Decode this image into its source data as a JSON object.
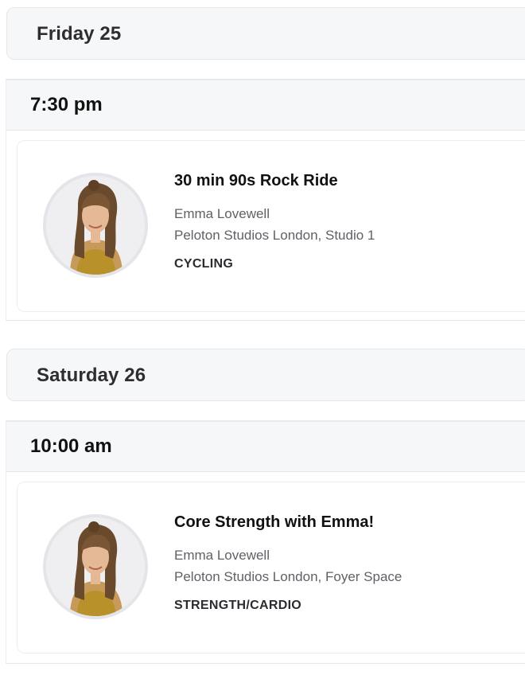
{
  "schedule": [
    {
      "day": "Friday 25",
      "time": "7:30 pm",
      "class": {
        "title": "30 min 90s Rock Ride",
        "instructor": "Emma Lovewell",
        "location": "Peloton Studios London, Studio 1",
        "category": "CYCLING",
        "avatar_icon": "instructor-photo"
      }
    },
    {
      "day": "Saturday 26",
      "time": "10:00 am",
      "class": {
        "title": "Core Strength with Emma!",
        "instructor": "Emma Lovewell",
        "location": "Peloton Studios London, Foyer Space",
        "category": "STRENGTH/CARDIO",
        "avatar_icon": "instructor-photo"
      }
    }
  ],
  "colors": {
    "header_bg": "#f6f7f9",
    "border": "#e6e7ea",
    "muted_text": "#5f6166",
    "outfit": "#b8912a"
  }
}
